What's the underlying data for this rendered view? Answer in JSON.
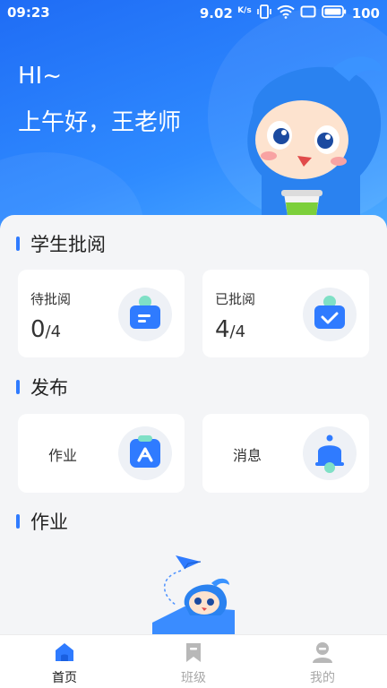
{
  "status_bar": {
    "time": "09:23",
    "speed": "9.02",
    "speed_unit": "K/s",
    "battery": "100"
  },
  "greeting": {
    "hi": "HI~",
    "message": "上午好，王老师"
  },
  "sections": {
    "review": {
      "title": "学生批阅",
      "cards": [
        {
          "label": "待批阅",
          "count": "0",
          "total": "/4",
          "icon": "pending-tray-icon"
        },
        {
          "label": "已批阅",
          "count": "4",
          "total": "/4",
          "icon": "reviewed-check-icon"
        }
      ]
    },
    "publish": {
      "title": "发布",
      "cards": [
        {
          "label": "作业",
          "icon": "homework-icon"
        },
        {
          "label": "消息",
          "icon": "bell-icon"
        }
      ]
    },
    "homework": {
      "title": "作业"
    }
  },
  "tabbar": {
    "items": [
      {
        "label": "首页",
        "icon": "home-icon",
        "active": true
      },
      {
        "label": "班级",
        "icon": "bookmark-icon",
        "active": false
      },
      {
        "label": "我的",
        "icon": "user-icon",
        "active": false
      }
    ]
  },
  "colors": {
    "accent": "#2f7bff",
    "tab_active": "#1a1a1a",
    "tab_inactive": "#a8a8a8",
    "icon_teal": "#7fe0c6"
  }
}
